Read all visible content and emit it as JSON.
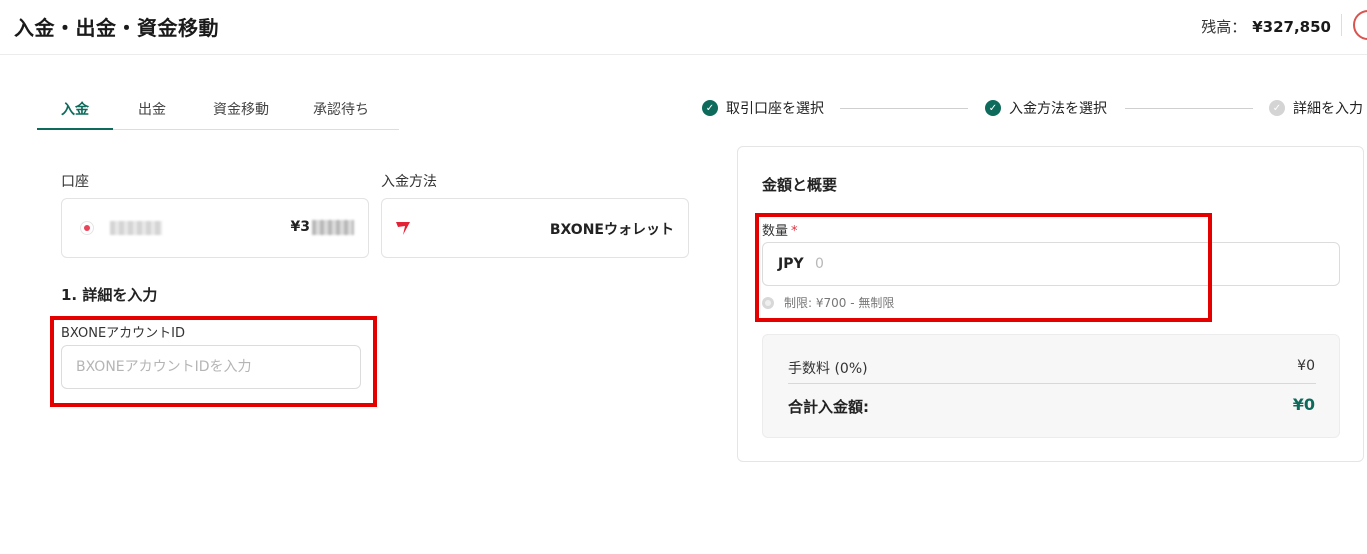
{
  "header": {
    "title": "入金・出金・資金移動",
    "balance_label": "残高：",
    "balance_value": "¥327,850"
  },
  "tabs": [
    {
      "label": "入金",
      "active": true
    },
    {
      "label": "出金",
      "active": false
    },
    {
      "label": "資金移動",
      "active": false
    },
    {
      "label": "承認待ち",
      "active": false
    }
  ],
  "steps": [
    {
      "label": "取引口座を選択",
      "done": true
    },
    {
      "label": "入金方法を選択",
      "done": true
    },
    {
      "label": "詳細を入力",
      "done": false
    }
  ],
  "account": {
    "label": "口座",
    "amount_visible": "¥3"
  },
  "method": {
    "label": "入金方法",
    "name": "BXONEウォレット"
  },
  "details": {
    "section_title": "1. 詳細を入力",
    "field_label": "BXONEアカウントID",
    "placeholder": "BXONEアカウントIDを入力",
    "value": ""
  },
  "summary_panel": {
    "title": "金額と概要",
    "quantity_label": "数量",
    "required_mark": "*",
    "currency": "JPY",
    "quantity_placeholder": "0",
    "limit_text": "制限: ¥700 - 無制限",
    "fee_label": "手数料 (0%)",
    "fee_value": "¥0",
    "total_label": "合計入金額:",
    "total_value": "¥0"
  },
  "colors": {
    "accent": "#0e6b5c",
    "highlight": "#e50000",
    "account_dot": "#e8455a"
  }
}
